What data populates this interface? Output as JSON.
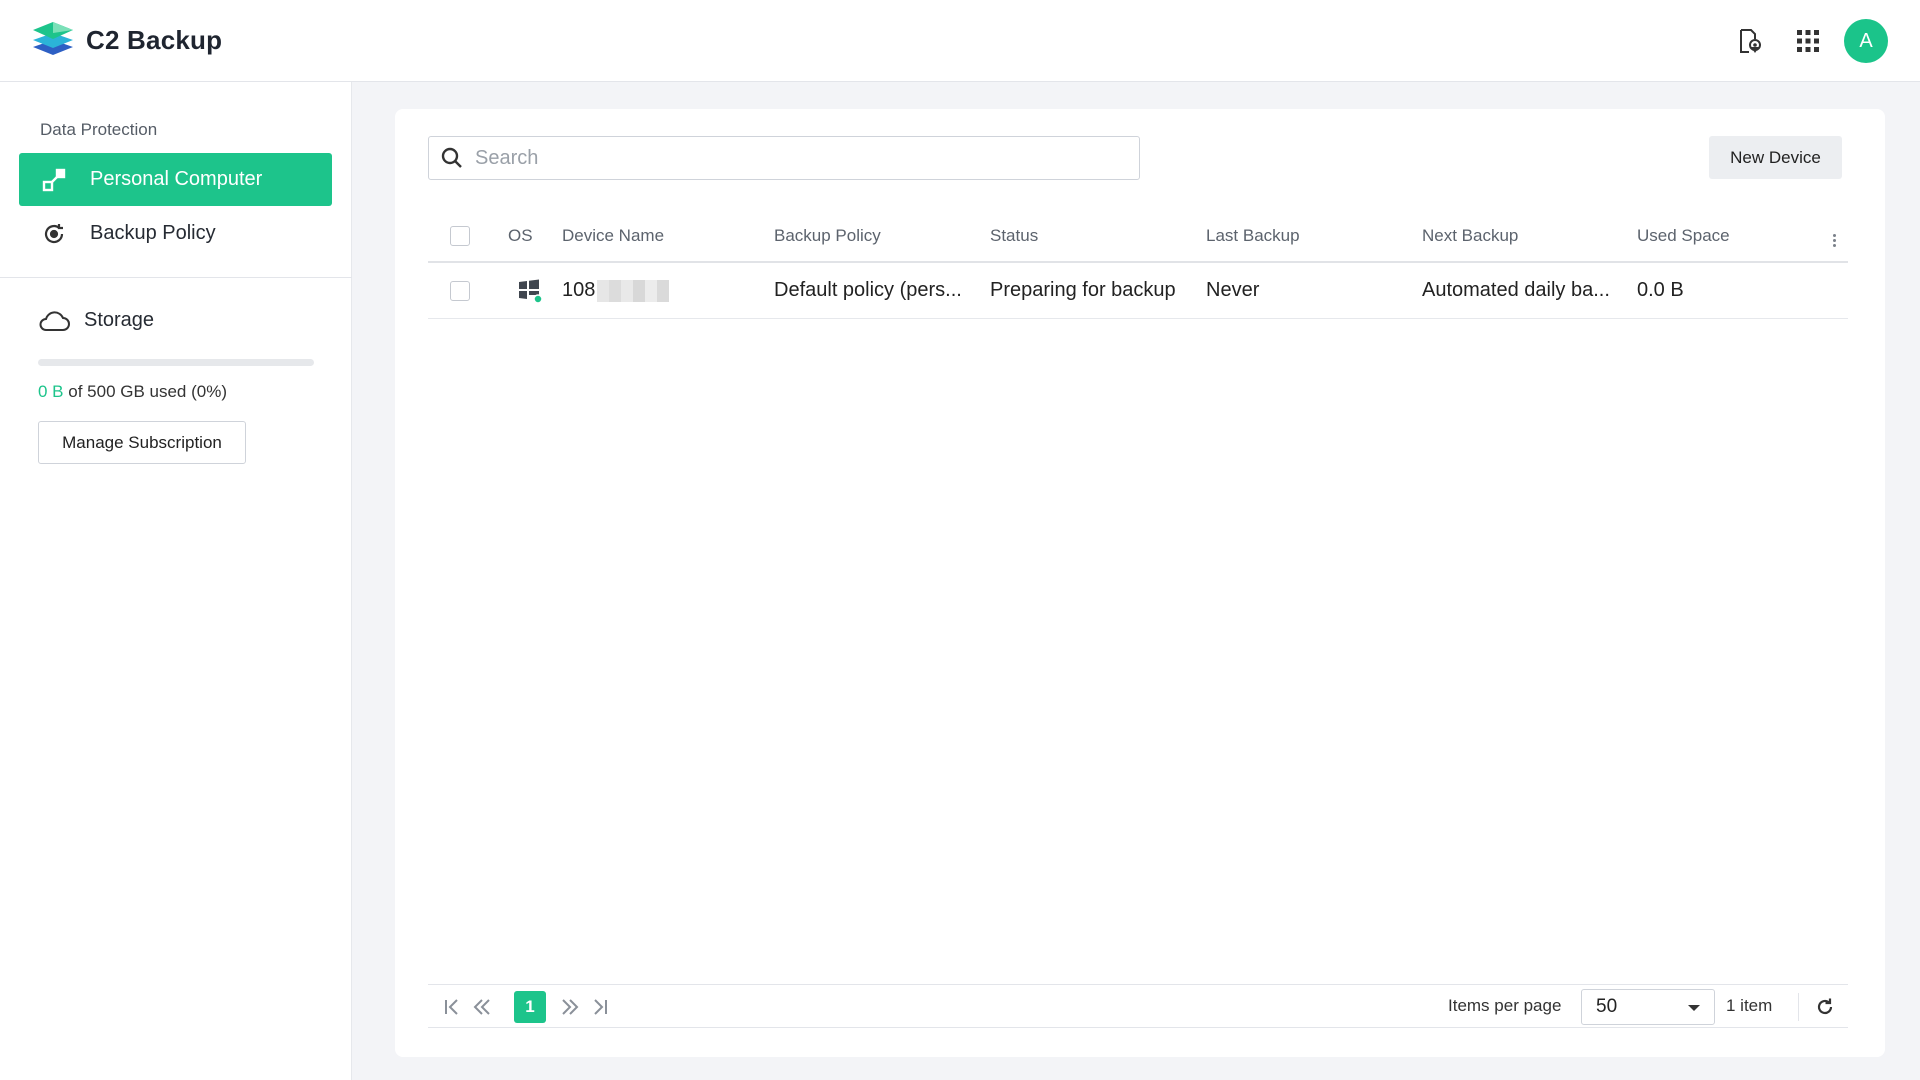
{
  "app": {
    "title": "C2 Backup",
    "avatar_letter": "A",
    "accent_color": "#1dc48b"
  },
  "header": {
    "icons": [
      "location-file-icon",
      "apps-grid-icon",
      "avatar"
    ]
  },
  "sidebar": {
    "section_label": "Data Protection",
    "items": [
      {
        "label": "Personal Computer",
        "icon": "computer-link-icon",
        "active": true
      },
      {
        "label": "Backup Policy",
        "icon": "backup-policy-icon",
        "active": false
      }
    ],
    "storage": {
      "label": "Storage",
      "used": "0 B",
      "usage_text": " of 500 GB used (0%)",
      "used_fraction": 0,
      "manage_label": "Manage Subscription"
    }
  },
  "toolbar": {
    "search_placeholder": "Search",
    "new_device_label": "New Device"
  },
  "table": {
    "columns": [
      "OS",
      "Device Name",
      "Backup Policy",
      "Status",
      "Last Backup",
      "Next Backup",
      "Used Space"
    ],
    "rows": [
      {
        "os": "windows-icon",
        "device_name": "108",
        "backup_policy": "Default policy (pers...",
        "status": "Preparing for backup",
        "last_backup": "Never",
        "next_backup": "Automated daily ba...",
        "used_space": "0.0 B"
      }
    ]
  },
  "pagination": {
    "current_page": "1",
    "items_per_page_label": "Items per page",
    "items_per_page": "50",
    "item_count": "1 item"
  }
}
